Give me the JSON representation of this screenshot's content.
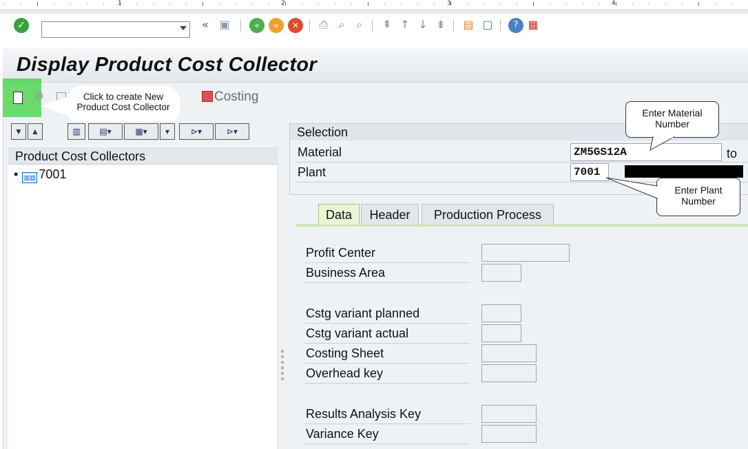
{
  "ruler": {
    "numbers": [
      "1",
      "2",
      "3",
      "4"
    ]
  },
  "system_toolbar": {
    "command_field": {
      "value": "",
      "placeholder": ""
    },
    "icons": [
      "enter-icon",
      "command-dropdown-icon",
      "collapse-icon",
      "save-icon",
      "back-icon",
      "exit-icon",
      "cancel-icon",
      "print-icon",
      "find-icon",
      "find-next-icon",
      "first-page-icon",
      "previous-page-icon",
      "next-page-icon",
      "last-page-icon",
      "create-session-icon",
      "shortcut-icon",
      "help-icon",
      "customize-layout-icon"
    ]
  },
  "title": "Display Product Cost Collector",
  "app_toolbar": {
    "costing_label": "Costing"
  },
  "callouts": {
    "new_collector": "Click to create New Product Cost Collector",
    "material": "Enter Material Number",
    "plant": "Enter Plant Number"
  },
  "tree": {
    "header": "Product Cost Collectors",
    "items": [
      {
        "label": "7001"
      }
    ]
  },
  "selection": {
    "header": "Selection",
    "material_label": "Material",
    "material_value": "ZM5GS12A",
    "to_label": "to",
    "plant_label": "Plant",
    "plant_value": "7001"
  },
  "tabs": [
    {
      "label": "Data",
      "active": true
    },
    {
      "label": "Header",
      "active": false
    },
    {
      "label": "Production Process",
      "active": false
    }
  ],
  "data_fields": [
    {
      "label": "Profit Center",
      "value": ""
    },
    {
      "label": "Business Area",
      "value": ""
    },
    {
      "label": "Cstg variant planned",
      "value": ""
    },
    {
      "label": "Cstg variant actual",
      "value": ""
    },
    {
      "label": "Costing Sheet",
      "value": ""
    },
    {
      "label": "Overhead key",
      "value": ""
    },
    {
      "label": "Results Analysis Key",
      "value": ""
    },
    {
      "label": "Variance Key",
      "value": ""
    }
  ],
  "colors": {
    "highlight": "#3cd23c",
    "tab_active": "#eaf5d8",
    "panel_bg": "#eff2f5"
  }
}
